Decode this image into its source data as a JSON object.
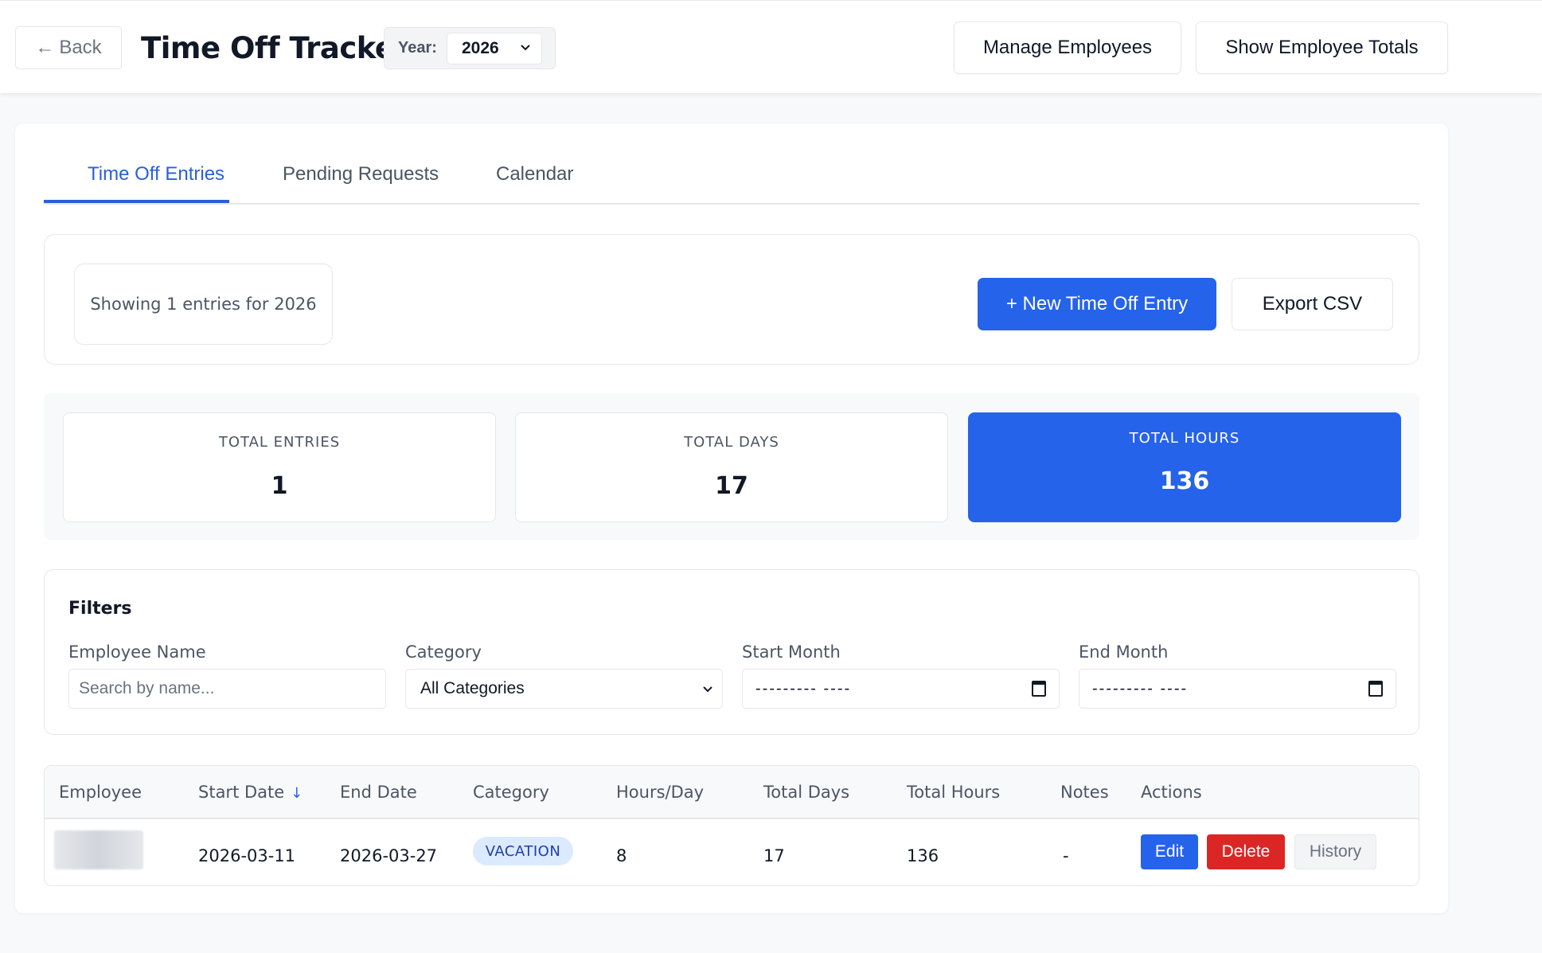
{
  "header": {
    "back_label": "Back",
    "title": "Time Off Tracker",
    "year_label": "Year:",
    "year_value": "2026",
    "manage_label": "Manage Employees",
    "totals_label": "Show Employee Totals"
  },
  "tabs": [
    {
      "label": "Time Off Entries",
      "active": true
    },
    {
      "label": "Pending Requests",
      "active": false
    },
    {
      "label": "Calendar",
      "active": false
    }
  ],
  "actions": {
    "showing_text": "Showing 1 entries for 2026",
    "new_entry_label": "+ New Time Off Entry",
    "export_label": "Export CSV"
  },
  "stats": [
    {
      "label": "TOTAL ENTRIES",
      "value": "1"
    },
    {
      "label": "TOTAL DAYS",
      "value": "17"
    },
    {
      "label": "TOTAL HOURS",
      "value": "136"
    }
  ],
  "filters": {
    "title": "Filters",
    "employee_label": "Employee Name",
    "employee_placeholder": "Search by name...",
    "category_label": "Category",
    "category_value": "All Categories",
    "start_label": "Start Month",
    "start_value": "---------  ----",
    "end_label": "End Month",
    "end_value": "---------  ----"
  },
  "table": {
    "columns": [
      "Employee",
      "Start Date",
      "End Date",
      "Category",
      "Hours/Day",
      "Total Days",
      "Total Hours",
      "Notes",
      "Actions"
    ],
    "sort_indicator": "↓",
    "rows": [
      {
        "employee": "",
        "start_date": "2026-03-11",
        "end_date": "2026-03-27",
        "category": "VACATION",
        "hours_per_day": "8",
        "total_days": "17",
        "total_hours": "136",
        "notes": "-",
        "edit_label": "Edit",
        "delete_label": "Delete",
        "history_label": "History"
      }
    ]
  },
  "colors": {
    "primary": "#2563eb",
    "danger": "#dc2626",
    "badge_bg": "#dbeafe",
    "badge_text": "#1e40af"
  }
}
